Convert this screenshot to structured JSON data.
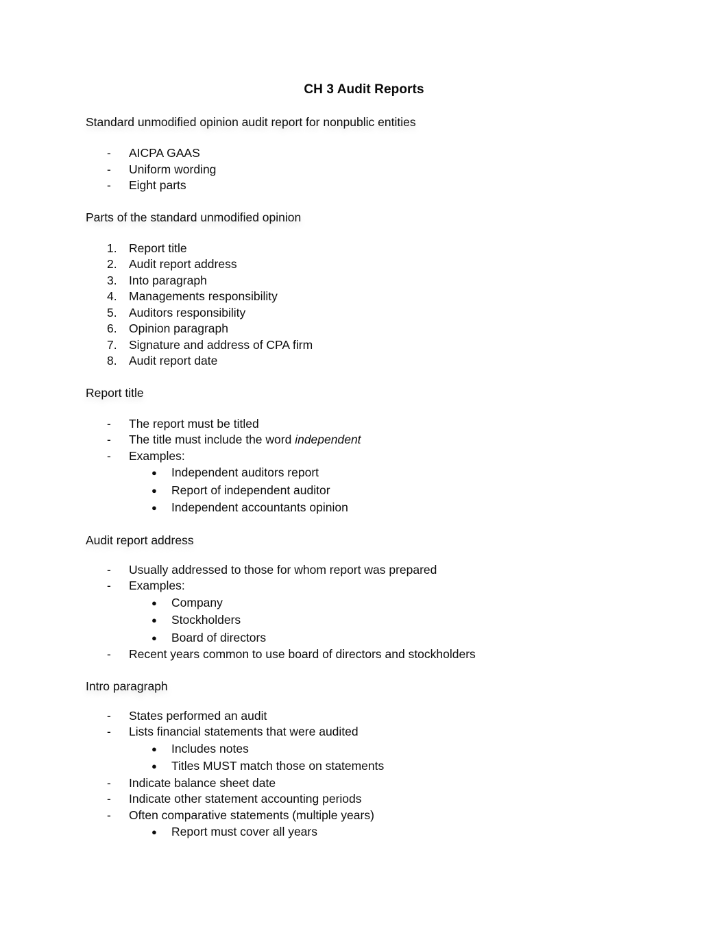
{
  "document": {
    "title": "CH 3 Audit Reports"
  },
  "sections": [
    {
      "heading": "Standard unmodified opinion audit report for nonpublic entities",
      "items": [
        {
          "marker": "-",
          "text": "AICPA GAAS"
        },
        {
          "marker": "-",
          "text": "Uniform wording"
        },
        {
          "marker": "-",
          "text": "Eight parts"
        }
      ]
    },
    {
      "heading": "Parts of the standard unmodified opinion",
      "items": [
        {
          "marker": "1.",
          "text": "Report title"
        },
        {
          "marker": "2.",
          "text": "Audit report address"
        },
        {
          "marker": "3.",
          "text": "Into paragraph"
        },
        {
          "marker": "4.",
          "text": "Managements responsibility"
        },
        {
          "marker": "5.",
          "text": "Auditors responsibility"
        },
        {
          "marker": "6.",
          "text": "Opinion paragraph"
        },
        {
          "marker": "7.",
          "text": "Signature and address of CPA firm"
        },
        {
          "marker": "8.",
          "text": "Audit report date"
        }
      ]
    },
    {
      "heading": "Report title",
      "items": [
        {
          "marker": "-",
          "text": "The report must be titled"
        },
        {
          "marker": "-",
          "text_before_italic": "The title must include the word ",
          "italic_text": "independent"
        },
        {
          "marker": "-",
          "text": "Examples:"
        },
        {
          "marker": "●",
          "text": "Independent auditors report"
        },
        {
          "marker": "●",
          "text": "Report of independent auditor"
        },
        {
          "marker": "●",
          "text": "Independent accountants opinion"
        }
      ]
    },
    {
      "heading": "Audit report address",
      "items": [
        {
          "marker": "-",
          "text": "Usually addressed to those for whom report was prepared"
        },
        {
          "marker": "-",
          "text": "Examples:"
        },
        {
          "marker": "●",
          "text": "Company"
        },
        {
          "marker": "●",
          "text": "Stockholders"
        },
        {
          "marker": "●",
          "text": "Board of directors"
        },
        {
          "marker": "-",
          "text": "Recent years common to use board of directors and stockholders"
        }
      ]
    },
    {
      "heading": "Intro paragraph",
      "items": [
        {
          "marker": "-",
          "text": "States performed an audit"
        },
        {
          "marker": "-",
          "text": "Lists financial statements that were audited"
        },
        {
          "marker": "●",
          "text": "Includes notes"
        },
        {
          "marker": "●",
          "text": "Titles MUST match those on statements"
        },
        {
          "marker": "-",
          "text": "Indicate balance sheet date"
        },
        {
          "marker": "-",
          "text": "Indicate other statement accounting periods"
        },
        {
          "marker": "-",
          "text": "Often comparative statements (multiple years)"
        },
        {
          "marker": "●",
          "text": "Report must cover all years"
        }
      ]
    }
  ]
}
